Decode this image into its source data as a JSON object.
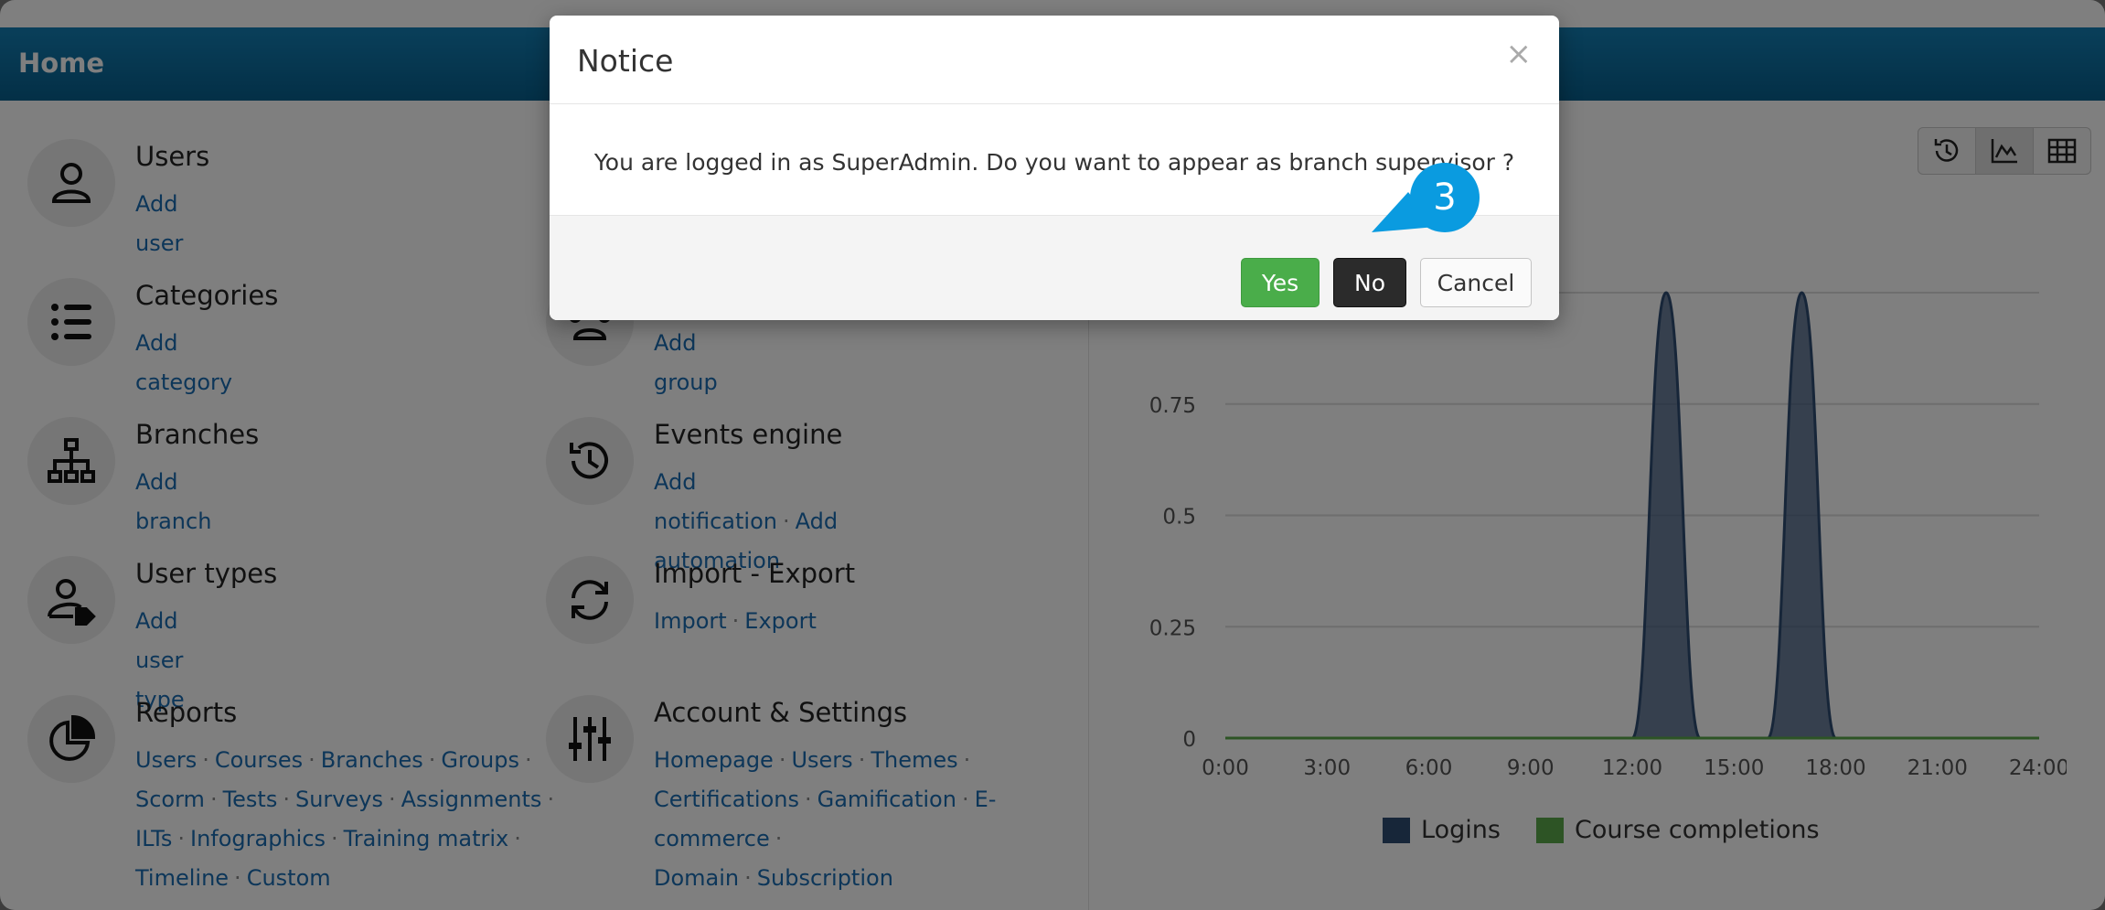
{
  "header": {
    "title": "Home"
  },
  "tiles": {
    "users": {
      "title": "Users",
      "links": [
        "Add user"
      ]
    },
    "categories": {
      "title": "Categories",
      "links": [
        "Add category"
      ]
    },
    "groups": {
      "links": [
        "Add group"
      ]
    },
    "branches": {
      "title": "Branches",
      "links": [
        "Add branch"
      ]
    },
    "events": {
      "title": "Events engine",
      "links": [
        "Add notification",
        "Add automation"
      ]
    },
    "usertypes": {
      "title": "User types",
      "links": [
        "Add user type"
      ]
    },
    "importexport": {
      "title": "Import - Export",
      "links": [
        "Import",
        "Export"
      ]
    },
    "reports": {
      "title": "Reports",
      "links": [
        "Users",
        "Courses",
        "Branches",
        "Groups",
        "Scorm",
        "Tests",
        "Surveys",
        "Assignments",
        "ILTs",
        "Infographics",
        "Training matrix",
        "Timeline",
        "Custom"
      ]
    },
    "account": {
      "title": "Account & Settings",
      "links": [
        "Homepage",
        "Users",
        "Themes",
        "Certifications",
        "Gamification",
        "E-commerce",
        "Domain",
        "Subscription"
      ]
    }
  },
  "view_buttons": [
    "history-icon",
    "area-chart-icon",
    "table-grid-icon"
  ],
  "chart_data": {
    "type": "area",
    "x_ticks": [
      "0:00",
      "3:00",
      "6:00",
      "9:00",
      "12:00",
      "15:00",
      "18:00",
      "21:00",
      "24:00"
    ],
    "y_ticks": [
      "0",
      "0.25",
      "0.5",
      "0.75"
    ],
    "ylim": [
      0,
      1
    ],
    "xlim": [
      0,
      24
    ],
    "series": [
      {
        "name": "Logins",
        "color": "#2f4c73",
        "x": [
          0,
          12,
          13,
          14,
          16,
          17,
          18,
          24
        ],
        "values": [
          0,
          0,
          1,
          0,
          0,
          1,
          0,
          0
        ]
      },
      {
        "name": "Course completions",
        "color": "#5aa84a",
        "x": [
          0,
          24
        ],
        "values": [
          0,
          0
        ]
      }
    ]
  },
  "modal": {
    "title": "Notice",
    "close": "×",
    "message": "You are logged in as SuperAdmin. Do you want to appear as branch supervisor ?",
    "yes": "Yes",
    "no": "No",
    "cancel": "Cancel"
  },
  "callout": {
    "step": "3",
    "color": "#0a9be0"
  }
}
